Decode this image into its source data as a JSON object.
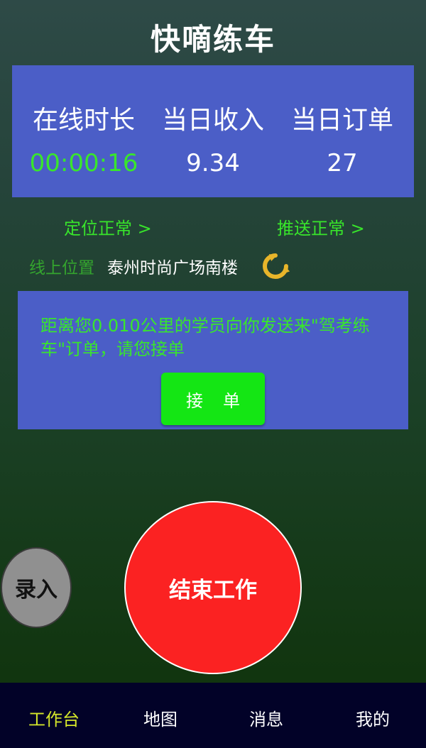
{
  "app": {
    "title": "快嘀练车"
  },
  "stats": {
    "online_duration": {
      "label": "在线时长",
      "value": "00:00:16"
    },
    "daily_income": {
      "label": "当日收入",
      "value": "9.34"
    },
    "daily_orders": {
      "label": "当日订单",
      "value": "27"
    }
  },
  "status": {
    "location": "定位正常 >",
    "push": "推送正常 >"
  },
  "location": {
    "label": "线上位置",
    "value": "泰州时尚广场南楼",
    "refresh_icon": "refresh-icon",
    "refresh_color": "#e8b52a"
  },
  "order": {
    "message": "距离您0.010公里的学员向你发送来\"驾考练车\"订单，请您接单",
    "accept_label": "接单"
  },
  "actions": {
    "end_work_label": "结束工作",
    "entry_label": "录入"
  },
  "nav": {
    "items": [
      {
        "label": "工作台",
        "active": true
      },
      {
        "label": "地图",
        "active": false
      },
      {
        "label": "消息",
        "active": false
      },
      {
        "label": "我的",
        "active": false
      }
    ]
  },
  "colors": {
    "panel": "#4b5ec7",
    "accent_green": "#39e62c",
    "end_button": "#fb2222",
    "nav_bg": "#020228",
    "nav_active": "#d6e82a"
  }
}
